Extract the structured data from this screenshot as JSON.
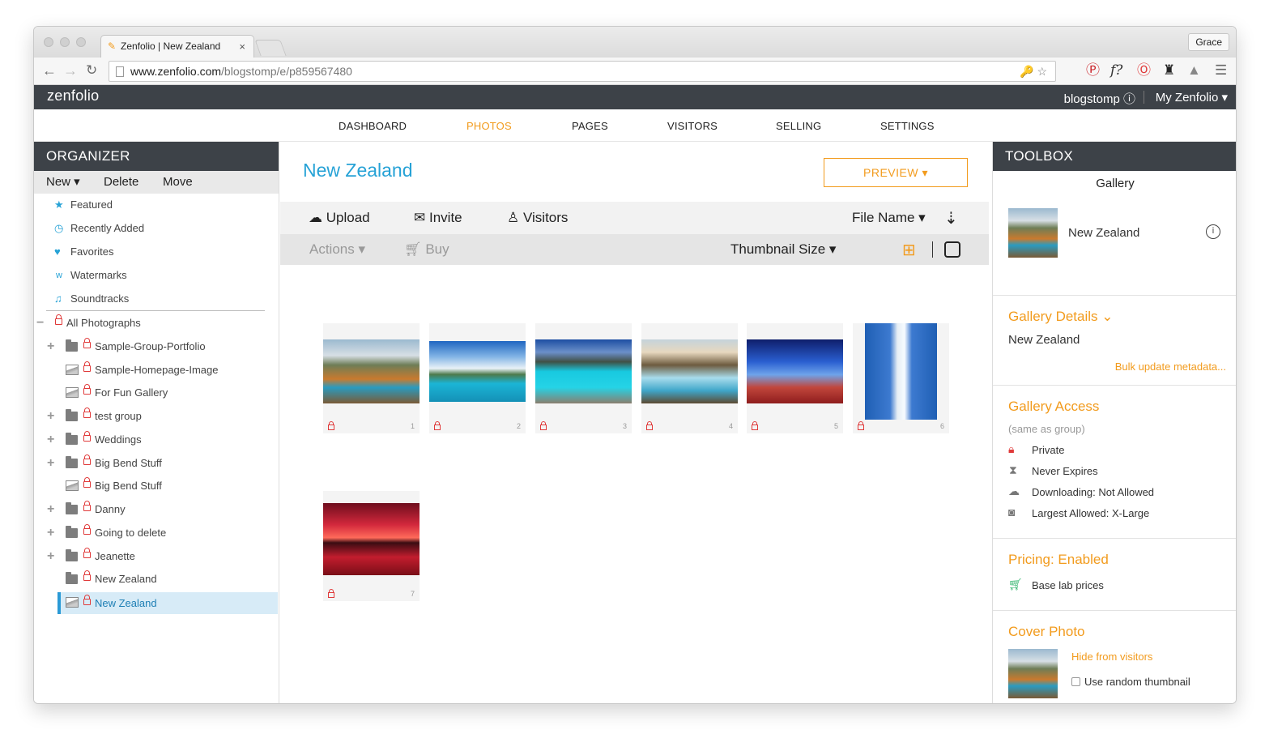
{
  "browser": {
    "tab_title": "Zenfolio | New Zealand",
    "tab_close": "×",
    "profile": "Grace",
    "url_host": "www.zenfolio.com",
    "url_path": "/blogstomp/e/p859567480"
  },
  "header": {
    "logo": "zenfolio",
    "user": "blogstomp ⓘ",
    "my_zenfolio": "My Zenfolio ▾"
  },
  "nav": {
    "items": [
      "DASHBOARD",
      "PHOTOS",
      "PAGES",
      "VISITORS",
      "SELLING",
      "SETTINGS"
    ],
    "active": "PHOTOS"
  },
  "organizer": {
    "title": "ORGANIZER",
    "tools": {
      "new": "New ▾",
      "delete": "Delete",
      "move": "Move"
    },
    "quick": [
      "Featured",
      "Recently Added",
      "Favorites",
      "Watermarks",
      "Soundtracks"
    ],
    "tree": [
      "All Photographs",
      "Sample-Group-Portfolio",
      "Sample-Homepage-Image",
      "For Fun Gallery",
      "test group",
      "Weddings",
      "Big Bend Stuff",
      "Big Bend Stuff",
      "Danny",
      "Going to delete",
      "Jeanette",
      "New Zealand",
      "New Zealand"
    ]
  },
  "gallery": {
    "title": "New Zealand",
    "preview": "PREVIEW ▾",
    "upload": "Upload",
    "invite": "Invite",
    "visitors": "Visitors",
    "sort": "File Name ▾",
    "actions": "Actions ▾",
    "buy": "Buy",
    "thumb_size": "Thumbnail Size ▾",
    "thumbs": [
      "1",
      "2",
      "3",
      "4",
      "5",
      "6",
      "7"
    ]
  },
  "toolbox": {
    "title": "TOOLBOX",
    "tab": "Gallery",
    "gallery_name": "New Zealand",
    "details_head": "Gallery Details ⌄",
    "details_value": "New Zealand",
    "bulk": "Bulk update metadata...",
    "access_head": "Gallery Access",
    "access_note": "(same as group)",
    "access": [
      "Private",
      "Never Expires",
      "Downloading: Not Allowed",
      "Largest Allowed: X-Large"
    ],
    "pricing_head": "Pricing: Enabled",
    "pricing_value": "Base lab prices",
    "cover_head": "Cover Photo",
    "hide": "Hide from visitors",
    "random": "Use random thumbnail"
  },
  "colors": {
    "accent": "#f29b1d",
    "title_blue": "#26a2d6",
    "dark_bar": "#3d4248"
  }
}
